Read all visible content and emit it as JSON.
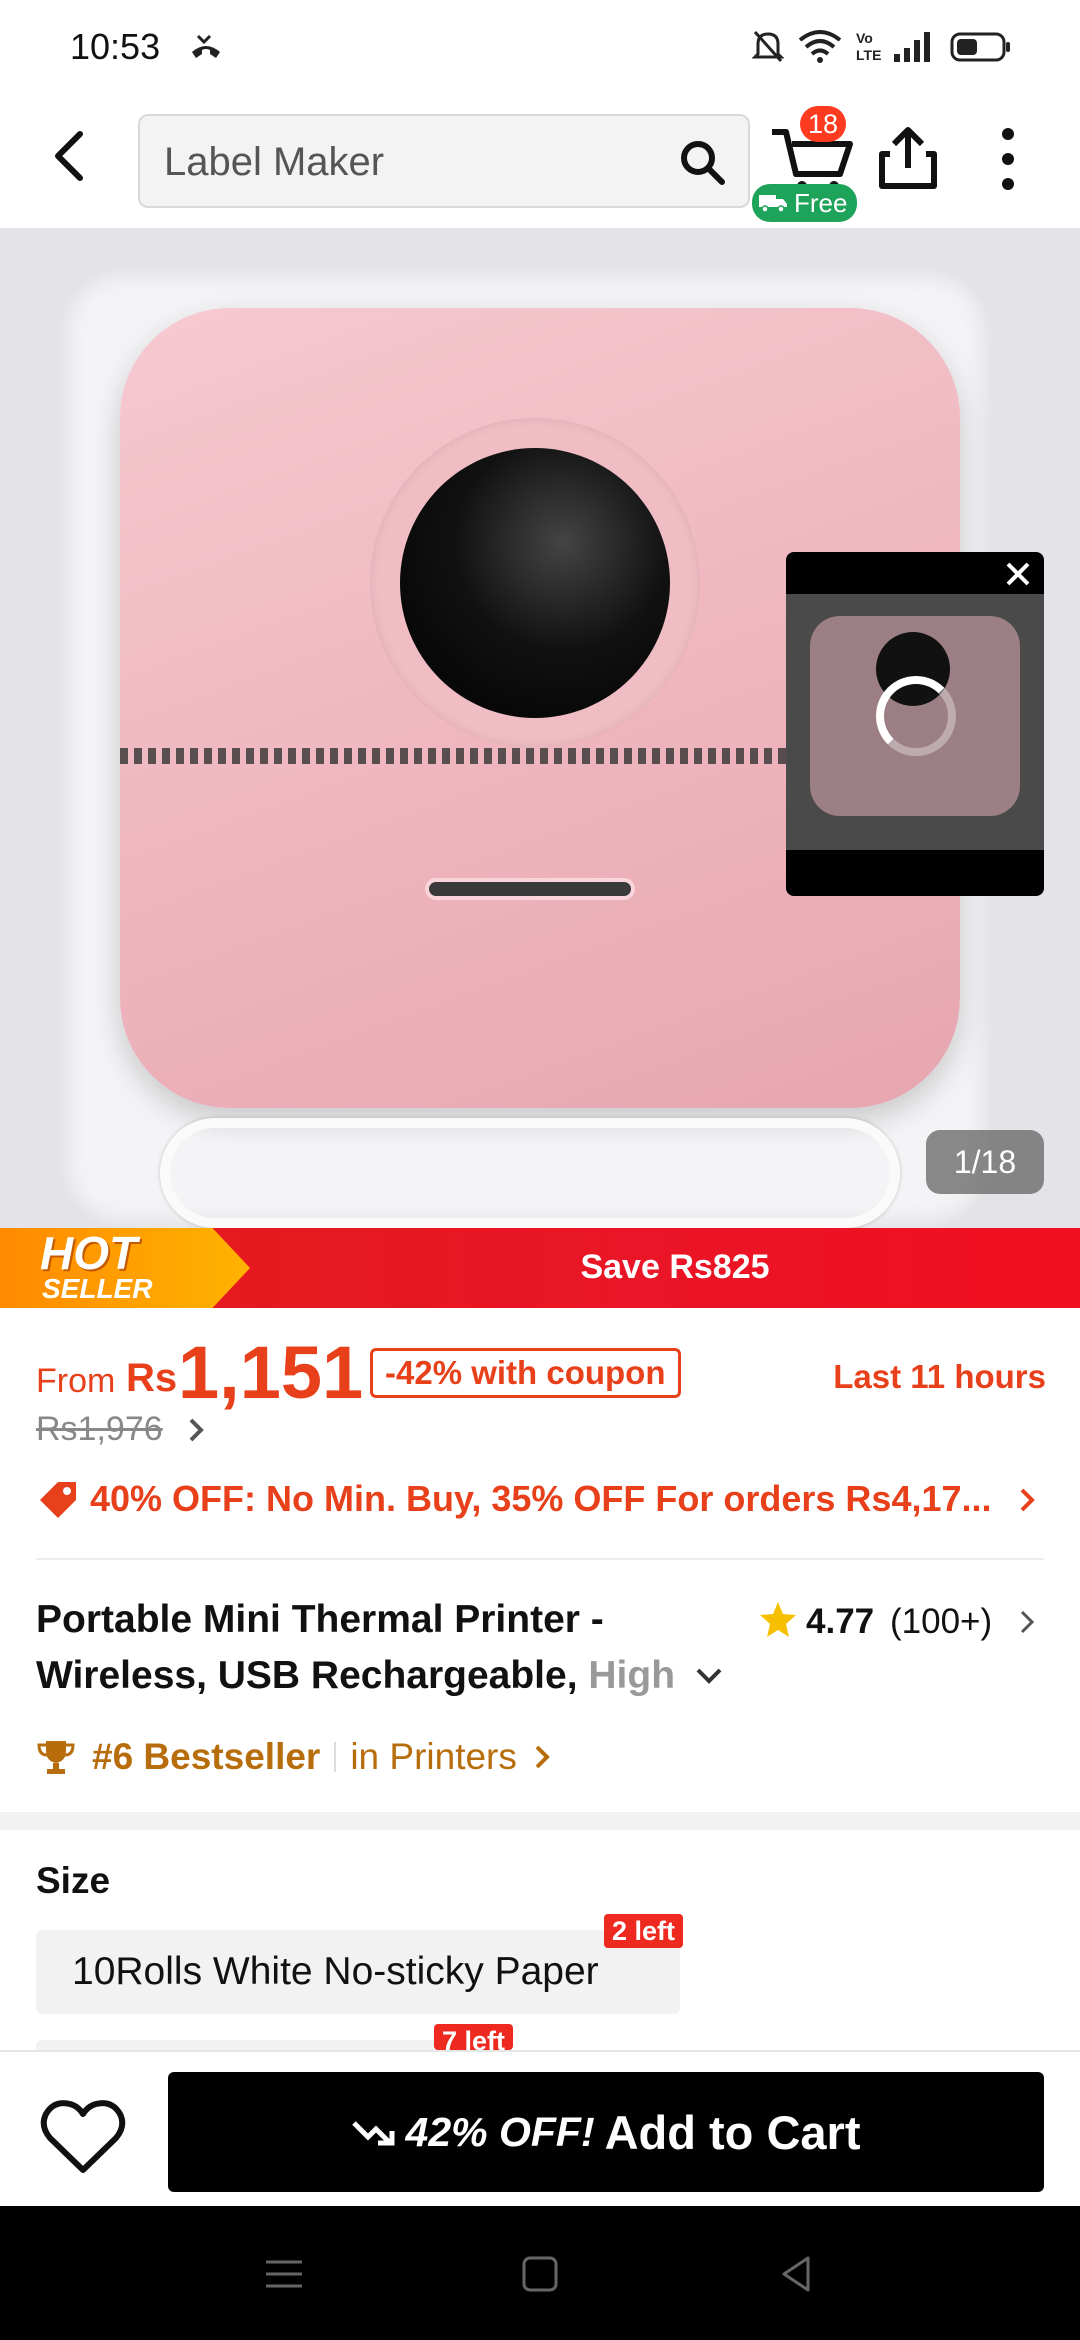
{
  "status_bar": {
    "time": "10:53",
    "icons": [
      "missed-call-icon",
      "mute-icon",
      "wifi-icon",
      "volte-icon",
      "signal-icon",
      "battery-icon"
    ]
  },
  "header": {
    "search_text": "Label Maker",
    "cart_count": "18",
    "free_label": "Free"
  },
  "gallery": {
    "counter": "1/18"
  },
  "banner": {
    "hot": "HOT",
    "seller": "SELLER",
    "save": "Save Rs825"
  },
  "price": {
    "from": "From",
    "currency": "Rs",
    "amount": "1,151",
    "coupon": "-42% with coupon",
    "timer": "Last 11 hours",
    "original": "Rs1,976"
  },
  "promo": {
    "text": "40% OFF: No Min. Buy,  35% OFF For orders Rs4,17..."
  },
  "product": {
    "title_main": "Portable Mini Thermal Printer - Wireless, USB Rechargeable, ",
    "title_fade": "High",
    "rating": "4.77",
    "rating_count": "(100+)",
    "bestseller": "#6 Bestseller",
    "category": "in Printers"
  },
  "size": {
    "label": "Size",
    "options": [
      {
        "label": "10Rolls White No-sticky Paper",
        "stock": "2 left"
      },
      {
        "label": "",
        "stock": "7 left"
      }
    ]
  },
  "cta": {
    "off": "42% OFF!",
    "label": "Add to Cart"
  },
  "colors": {
    "accent": "#e8401a",
    "banner_red": "#e21b1b",
    "gold": "#b86d0c",
    "free_green": "#1ea35a"
  }
}
